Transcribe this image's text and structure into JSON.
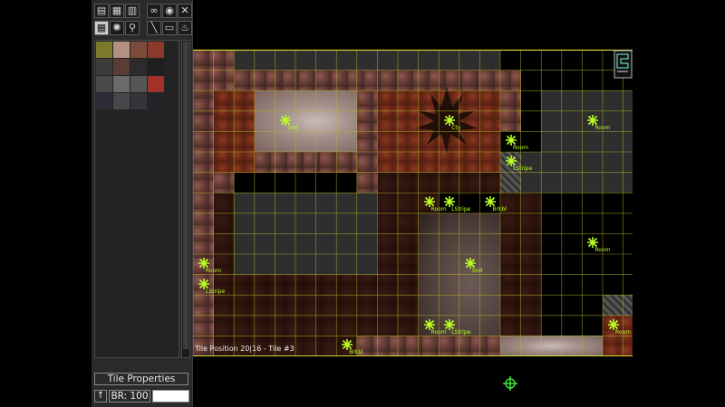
{
  "toolbar": {
    "row1": [
      {
        "name": "clipboard-icon",
        "glyph": "▤"
      },
      {
        "name": "save-icon",
        "glyph": "▦"
      },
      {
        "name": "disk-icon",
        "glyph": "▥"
      },
      {
        "name": "link-icon",
        "glyph": "∞"
      },
      {
        "name": "eye-icon",
        "glyph": "◉"
      },
      {
        "name": "close-icon",
        "glyph": "✕"
      }
    ],
    "row2": [
      {
        "name": "tiles-icon",
        "glyph": "▦"
      },
      {
        "name": "sun-icon",
        "glyph": "✺"
      },
      {
        "name": "paint-icon",
        "glyph": "⚲"
      },
      {
        "name": "wand-icon",
        "glyph": "╲"
      },
      {
        "name": "layer-icon",
        "glyph": "▭"
      },
      {
        "name": "fire-icon",
        "glyph": "♨"
      }
    ]
  },
  "palette": {
    "swatches": [
      [
        "#7c7a2a",
        "#b39180",
        "#7a4a3a",
        "#8a3a2a"
      ],
      [
        "#3c3c3c",
        "#5a3e36",
        "#2c2c2c",
        "#1f1f1f"
      ],
      [
        "#4a4a4a",
        "#6a6a6a",
        "#555555",
        "#a0322a"
      ],
      [
        "#2c2c34",
        "#48484c",
        "#34343a",
        "#23232a"
      ]
    ]
  },
  "panel": {
    "tile_properties_label": "Tile Properties",
    "brush_label": "BR: 100",
    "value_field": ""
  },
  "map": {
    "status": "Tile Position 20|16  -  Tile #3",
    "markers": [
      {
        "label": "Snd",
        "col": 4,
        "row": 3
      },
      {
        "label": "Cty",
        "col": 12,
        "row": 3
      },
      {
        "label": "Room",
        "col": 19,
        "row": 3
      },
      {
        "label": "Room",
        "col": 15,
        "row": 4
      },
      {
        "label": "LStripe",
        "col": 15,
        "row": 5
      },
      {
        "label": "Room",
        "col": 11,
        "row": 7
      },
      {
        "label": "LStripe",
        "col": 12,
        "row": 7
      },
      {
        "label": "Brkbl",
        "col": 14,
        "row": 7
      },
      {
        "label": "Room",
        "col": 19,
        "row": 9
      },
      {
        "label": "Room",
        "col": 0,
        "row": 10
      },
      {
        "label": "Snd",
        "col": 13,
        "row": 10
      },
      {
        "label": "LStripe",
        "col": 0,
        "row": 11
      },
      {
        "label": "Room",
        "col": 11,
        "row": 13
      },
      {
        "label": "LStripe",
        "col": 12,
        "row": 13
      },
      {
        "label": "Room",
        "col": 20,
        "row": 13
      },
      {
        "label": "Brkbl",
        "col": 7,
        "row": 14
      }
    ]
  },
  "colors": {
    "grid": "#b8b828",
    "marker": "#b9ff22",
    "panel_bg": "#2a2a2a"
  }
}
